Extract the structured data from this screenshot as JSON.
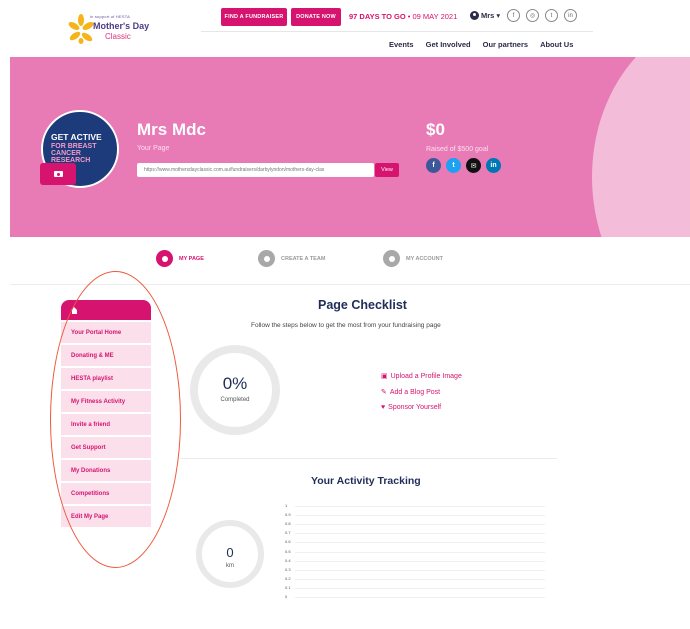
{
  "header": {
    "logo_small": "in support of HESTA",
    "logo_line1": "Mother's Day",
    "logo_line2": "Classic",
    "btn_fundraiser": "FIND A FUNDRAISER",
    "btn_donate": "DONATE NOW",
    "countdown": "97 DAYS TO GO",
    "countdown_date": " • 09 MAY 2021",
    "user_label": "Mrs",
    "user_caret": "▾",
    "socials": [
      "f",
      "◎",
      "t",
      "in"
    ],
    "nav": [
      "Events",
      "Get Involved",
      "Our partners",
      "About Us"
    ]
  },
  "hero": {
    "badge_line1": "GET ACTIVE",
    "badge_line2": "FOR BREAST CANCER RESEARCH",
    "name": "Mrs Mdc",
    "subtitle": "Your Page",
    "url": "https://www.mothersdayclassic.com.au/fundraisers/darbylyndon/mothers-day-clas",
    "view_label": "View",
    "amount": "$0",
    "goal_text": "Raised of $500 goal",
    "share_icons": [
      {
        "icon": "facebook-icon",
        "glyph": "f",
        "color": "#3b5998"
      },
      {
        "icon": "twitter-icon",
        "glyph": "t",
        "color": "#1da1f2"
      },
      {
        "icon": "email-icon",
        "glyph": "✉",
        "color": "#111111"
      },
      {
        "icon": "linkedin-icon",
        "glyph": "in",
        "color": "#0077b5"
      }
    ]
  },
  "tabs": {
    "my_page": "MY PAGE",
    "create_team": "CREATE A TEAM",
    "my_account": "MY ACCOUNT"
  },
  "sidebar": {
    "items": [
      "Your Portal Home",
      "Donating & ME",
      "HESTA playlist",
      "My Fitness Activity",
      "Invite a friend",
      "Get Support",
      "My Donations",
      "Competitions",
      "Edit My Page"
    ]
  },
  "checklist": {
    "title": "Page Checklist",
    "subtitle": "Follow the steps below to get the most from your fundraising page",
    "percent": "0%",
    "percent_label": "Completed",
    "progress": 0,
    "items": [
      {
        "icon": "image-icon",
        "glyph": "▣",
        "label": "Upload a Profile Image"
      },
      {
        "icon": "edit-icon",
        "glyph": "✎",
        "label": "Add a Blog Post"
      },
      {
        "icon": "heart-icon",
        "glyph": "♥",
        "label": "Sponsor Yourself"
      }
    ]
  },
  "activity": {
    "title": "Your Activity Tracking",
    "distance": "0",
    "unit": "km",
    "y_ticks": [
      "1",
      "0.9",
      "0.8",
      "0.7",
      "0.6",
      "0.5",
      "0.4",
      "0.3",
      "0.2",
      "0.1",
      "0"
    ]
  },
  "colors": {
    "brand_pink": "#d6136e",
    "hero_bg": "#e87ab6",
    "sidebar_item_bg": "#fbe0ec",
    "navy": "#1f2d58"
  }
}
